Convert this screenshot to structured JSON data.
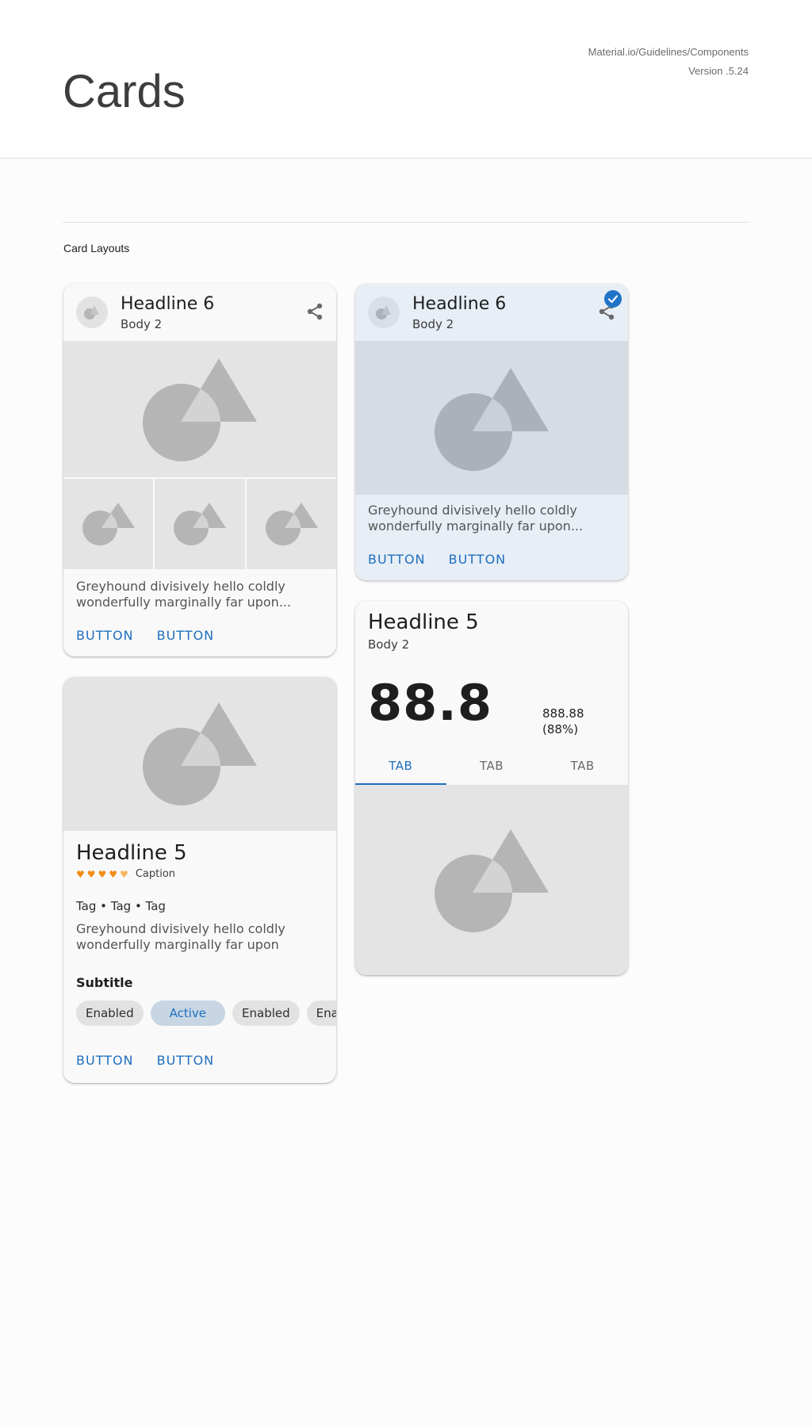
{
  "header": {
    "title": "Cards",
    "breadcrumb": "Material.io/Guidelines/Components",
    "version": "Version .5.24"
  },
  "section": {
    "title": "Card Layouts"
  },
  "card_gallery": {
    "headline": "Headline 6",
    "subhead": "Body 2",
    "body": "Greyhound divisively hello coldly wonderfully marginally far upon...",
    "buttons": [
      "BUTTON",
      "BUTTON"
    ]
  },
  "card_selected": {
    "headline": "Headline 6",
    "subhead": "Body 2",
    "body": "Greyhound divisively hello coldly wonderfully marginally far upon...",
    "buttons": [
      "BUTTON",
      "BUTTON"
    ]
  },
  "card_stats": {
    "headline": "Headline 5",
    "subhead": "Body 2",
    "big_number": "88.8",
    "stat_value": "888.88",
    "stat_percent": "(88%)",
    "tabs": [
      "TAB",
      "TAB",
      "TAB"
    ],
    "active_tab_index": 0
  },
  "card_detail": {
    "headline": "Headline 5",
    "rating_caption": "Caption",
    "rating": 4.5,
    "tags": "Tag • Tag • Tag",
    "body": "Greyhound divisively hello coldly wonderfully marginally far upon",
    "subtitle": "Subtitle",
    "chips": [
      "Enabled",
      "Active",
      "Enabled",
      "Enabled"
    ],
    "buttons": [
      "BUTTON",
      "BUTTON"
    ]
  },
  "icons": {
    "share": "share-icon",
    "check": "check-circle-icon",
    "media": "shapes-placeholder-icon",
    "avatar": "avatar-placeholder-icon",
    "heart": "heart-icon"
  },
  "colors": {
    "accent": "#1f6fbf",
    "selected_card_bg": "#e7eef6",
    "rating": "#f28c13",
    "placeholder_bg": "#e4e4e4",
    "placeholder_shape": "#b5b5b5"
  }
}
